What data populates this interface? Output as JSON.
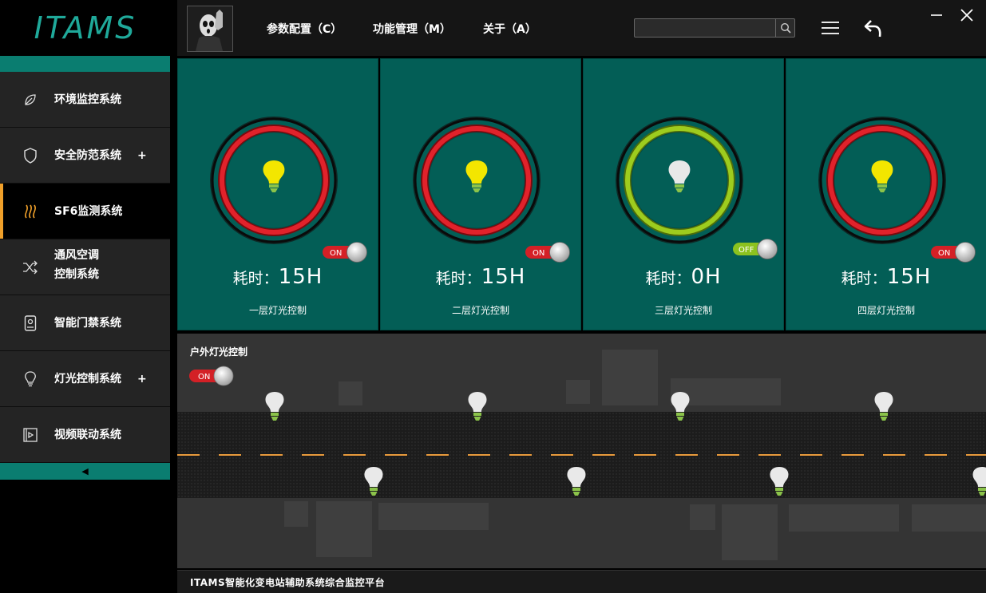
{
  "app": {
    "logo": "ITAMS"
  },
  "sidebar": {
    "items": [
      {
        "label": "环境监控系统",
        "icon": "leaf-icon",
        "plus": ""
      },
      {
        "label": "安全防范系统",
        "icon": "shield-icon",
        "plus": "+"
      },
      {
        "label": "SF6监测系统",
        "icon": "waves-icon",
        "plus": "",
        "active": true
      },
      {
        "label_line1": "通风空调",
        "label_line2": "控制系统",
        "icon": "shuffle-icon",
        "plus": ""
      },
      {
        "label": "智能门禁系统",
        "icon": "door-access-icon",
        "plus": ""
      },
      {
        "label": "灯光控制系统",
        "icon": "bulb-icon",
        "plus": "+"
      },
      {
        "label": "视频联动系统",
        "icon": "video-icon",
        "plus": ""
      }
    ],
    "collapse_glyph": "◀"
  },
  "topbar": {
    "menu": [
      "参数配置（C）",
      "功能管理（M）",
      "关于（A）"
    ],
    "search": {
      "value": "",
      "placeholder": ""
    }
  },
  "colors": {
    "accent": "#0a7d70",
    "card": "#035e56",
    "active_bar": "#f0a02a",
    "on_red": "#d9242a",
    "off_green": "#8cc21f"
  },
  "floors": [
    {
      "title": "一层灯光控制",
      "elapsed_label": "耗时：",
      "elapsed_value": "15H",
      "switch": "ON",
      "bulb_on": true
    },
    {
      "title": "二层灯光控制",
      "elapsed_label": "耗时：",
      "elapsed_value": "15H",
      "switch": "ON",
      "bulb_on": true
    },
    {
      "title": "三层灯光控制",
      "elapsed_label": "耗时：",
      "elapsed_value": "0H",
      "switch": "OFF",
      "bulb_on": false
    },
    {
      "title": "四层灯光控制",
      "elapsed_label": "耗时：",
      "elapsed_value": "15H",
      "switch": "ON",
      "bulb_on": true
    }
  ],
  "outdoor": {
    "title": "户外灯光控制",
    "switch": "ON"
  },
  "footer": {
    "text": "ITAMS智能化变电站辅助系统综合监控平台"
  }
}
